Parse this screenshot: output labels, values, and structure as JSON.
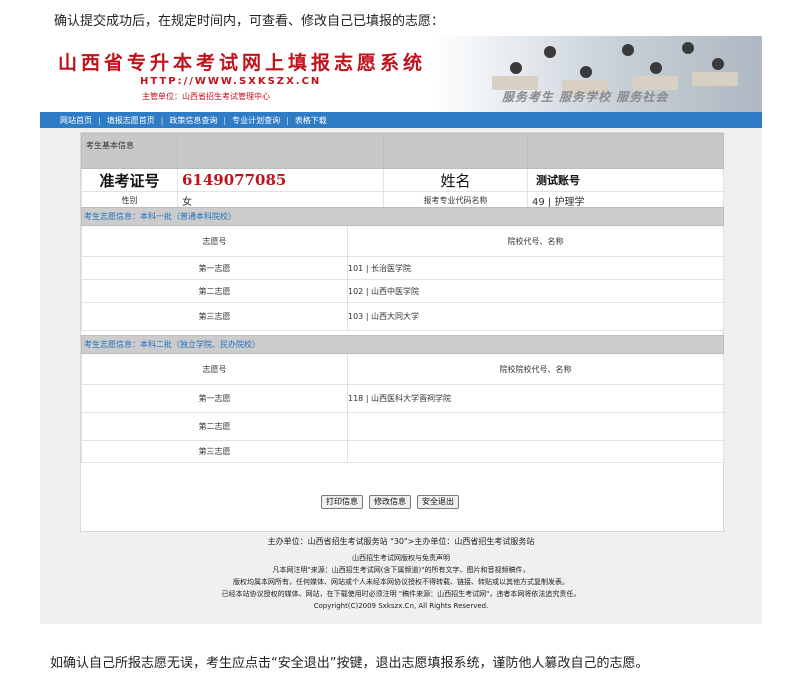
{
  "intro_text": "确认提交成功后，在规定时间内，可查看、修改自己已填报的志愿：",
  "outro_text": "如确认自己所报志愿无误，考生应点击“安全退出”按键，退出志愿填报系统，谨防他人篡改自己的志愿。",
  "banner": {
    "title": "山西省专升本考试网上填报志愿系统",
    "url": "HTTP://WWW.SXKSZX.CN",
    "host": "主管单位：山西省招生考试管理中心",
    "slogan": "服务考生  服务学校  服务社会"
  },
  "nav": [
    "网站首页",
    "填报志愿首页",
    "政策信息查询",
    "专业计划查询",
    "表格下载"
  ],
  "student": {
    "section_label": "考生基本信息",
    "exam_no_label": "准考证号",
    "exam_no": "6149077085",
    "name_label": "姓名",
    "account": "测试账号",
    "gender_label": "性别",
    "gender": "女",
    "major_label": "报考专业代码名称",
    "major": "49 | 护理学"
  },
  "batch1": {
    "title": "考生志愿信息：本科一批（普通本科院校）",
    "col_left": "志愿号",
    "col_right": "院校代号、名称",
    "rows": [
      {
        "label": "第一志愿",
        "school": "101 | 长治医学院"
      },
      {
        "label": "第二志愿",
        "school": "102 | 山西中医学院"
      },
      {
        "label": "第三志愿",
        "school": "103 | 山西大同大学"
      }
    ]
  },
  "batch2": {
    "title": "考生志愿信息：本科二批（独立学院、民办院校）",
    "col_left": "志愿号",
    "col_right": "院校院校代号、名称",
    "rows": [
      {
        "label": "第一志愿",
        "school": "118 | 山西医科大学晋祠学院"
      },
      {
        "label": "第二志愿",
        "school": ""
      },
      {
        "label": "第三志愿",
        "school": ""
      }
    ]
  },
  "buttons": {
    "print": "打印信息",
    "edit": "修改信息",
    "logout": "安全退出"
  },
  "footer": {
    "line1": "主办单位：山西省招生考试服务站 \"30\">主办单位：山西省招生考试服务站",
    "line2": "山西招生考试网版权与免责声明",
    "line3": "凡本网注明\"来源：山西招生考试网(含下属频道)\"的所有文字、图片和音视频稿件，",
    "line4": "版权均属本网所有，任何媒体、网站或个人未经本网协议授权不得转载、链接、转贴或以其他方式复制发表。",
    "line5": "已经本站协议授权的媒体、网站，在下载使用时必须注明 \"稿件来源：山西招生考试网\"，违者本网将依法追究责任。",
    "line6": "Copyright(C)2009 Sxkszx.Cn, All Rights Reserved."
  },
  "colors": {
    "brand_red": "#c0121a",
    "nav_blue": "#2f7cc6",
    "section_link": "#1f6fbf"
  }
}
